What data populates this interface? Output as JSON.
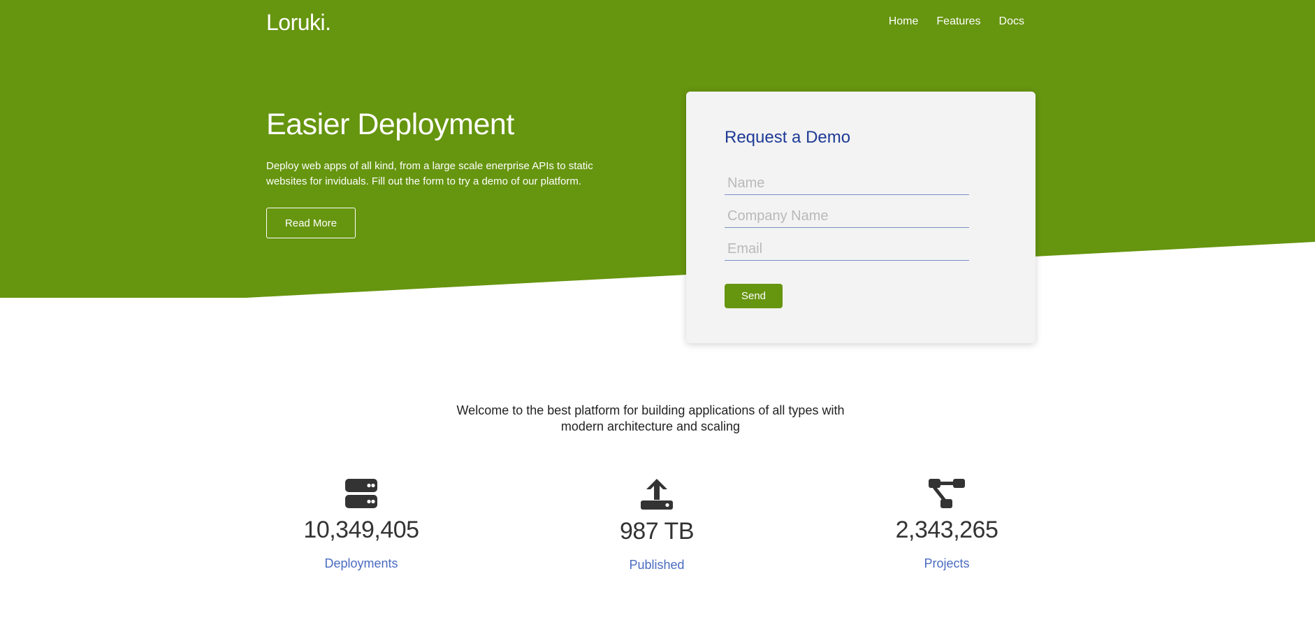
{
  "colors": {
    "hero_green": "#66950f",
    "demo_title_blue": "#1e3a94",
    "stat_label_blue": "#4a6bc0",
    "card_bg": "#f3f3f3"
  },
  "header": {
    "brand": "Loruki.",
    "nav": [
      "Home",
      "Features",
      "Docs"
    ]
  },
  "hero": {
    "title": "Easier Deployment",
    "text": "Deploy web apps of all kind, from a large scale enerprise APIs to static websites for inviduals. Fill out the form to try a demo of our platform.",
    "read_more": "Read More"
  },
  "demo_form": {
    "title": "Request a Demo",
    "name_placeholder": "Name",
    "company_placeholder": "Company Name",
    "email_placeholder": "Email",
    "send": "Send"
  },
  "welcome": "Welcome to the best platform for building applications of all types with modern architecture and scaling",
  "stats": [
    {
      "icon": "server-icon",
      "value": "10,349,405",
      "label": "Deployments"
    },
    {
      "icon": "upload-icon",
      "value": "987 TB",
      "label": "Published"
    },
    {
      "icon": "project-diagram-icon",
      "value": "2,343,265",
      "label": "Projects"
    }
  ]
}
